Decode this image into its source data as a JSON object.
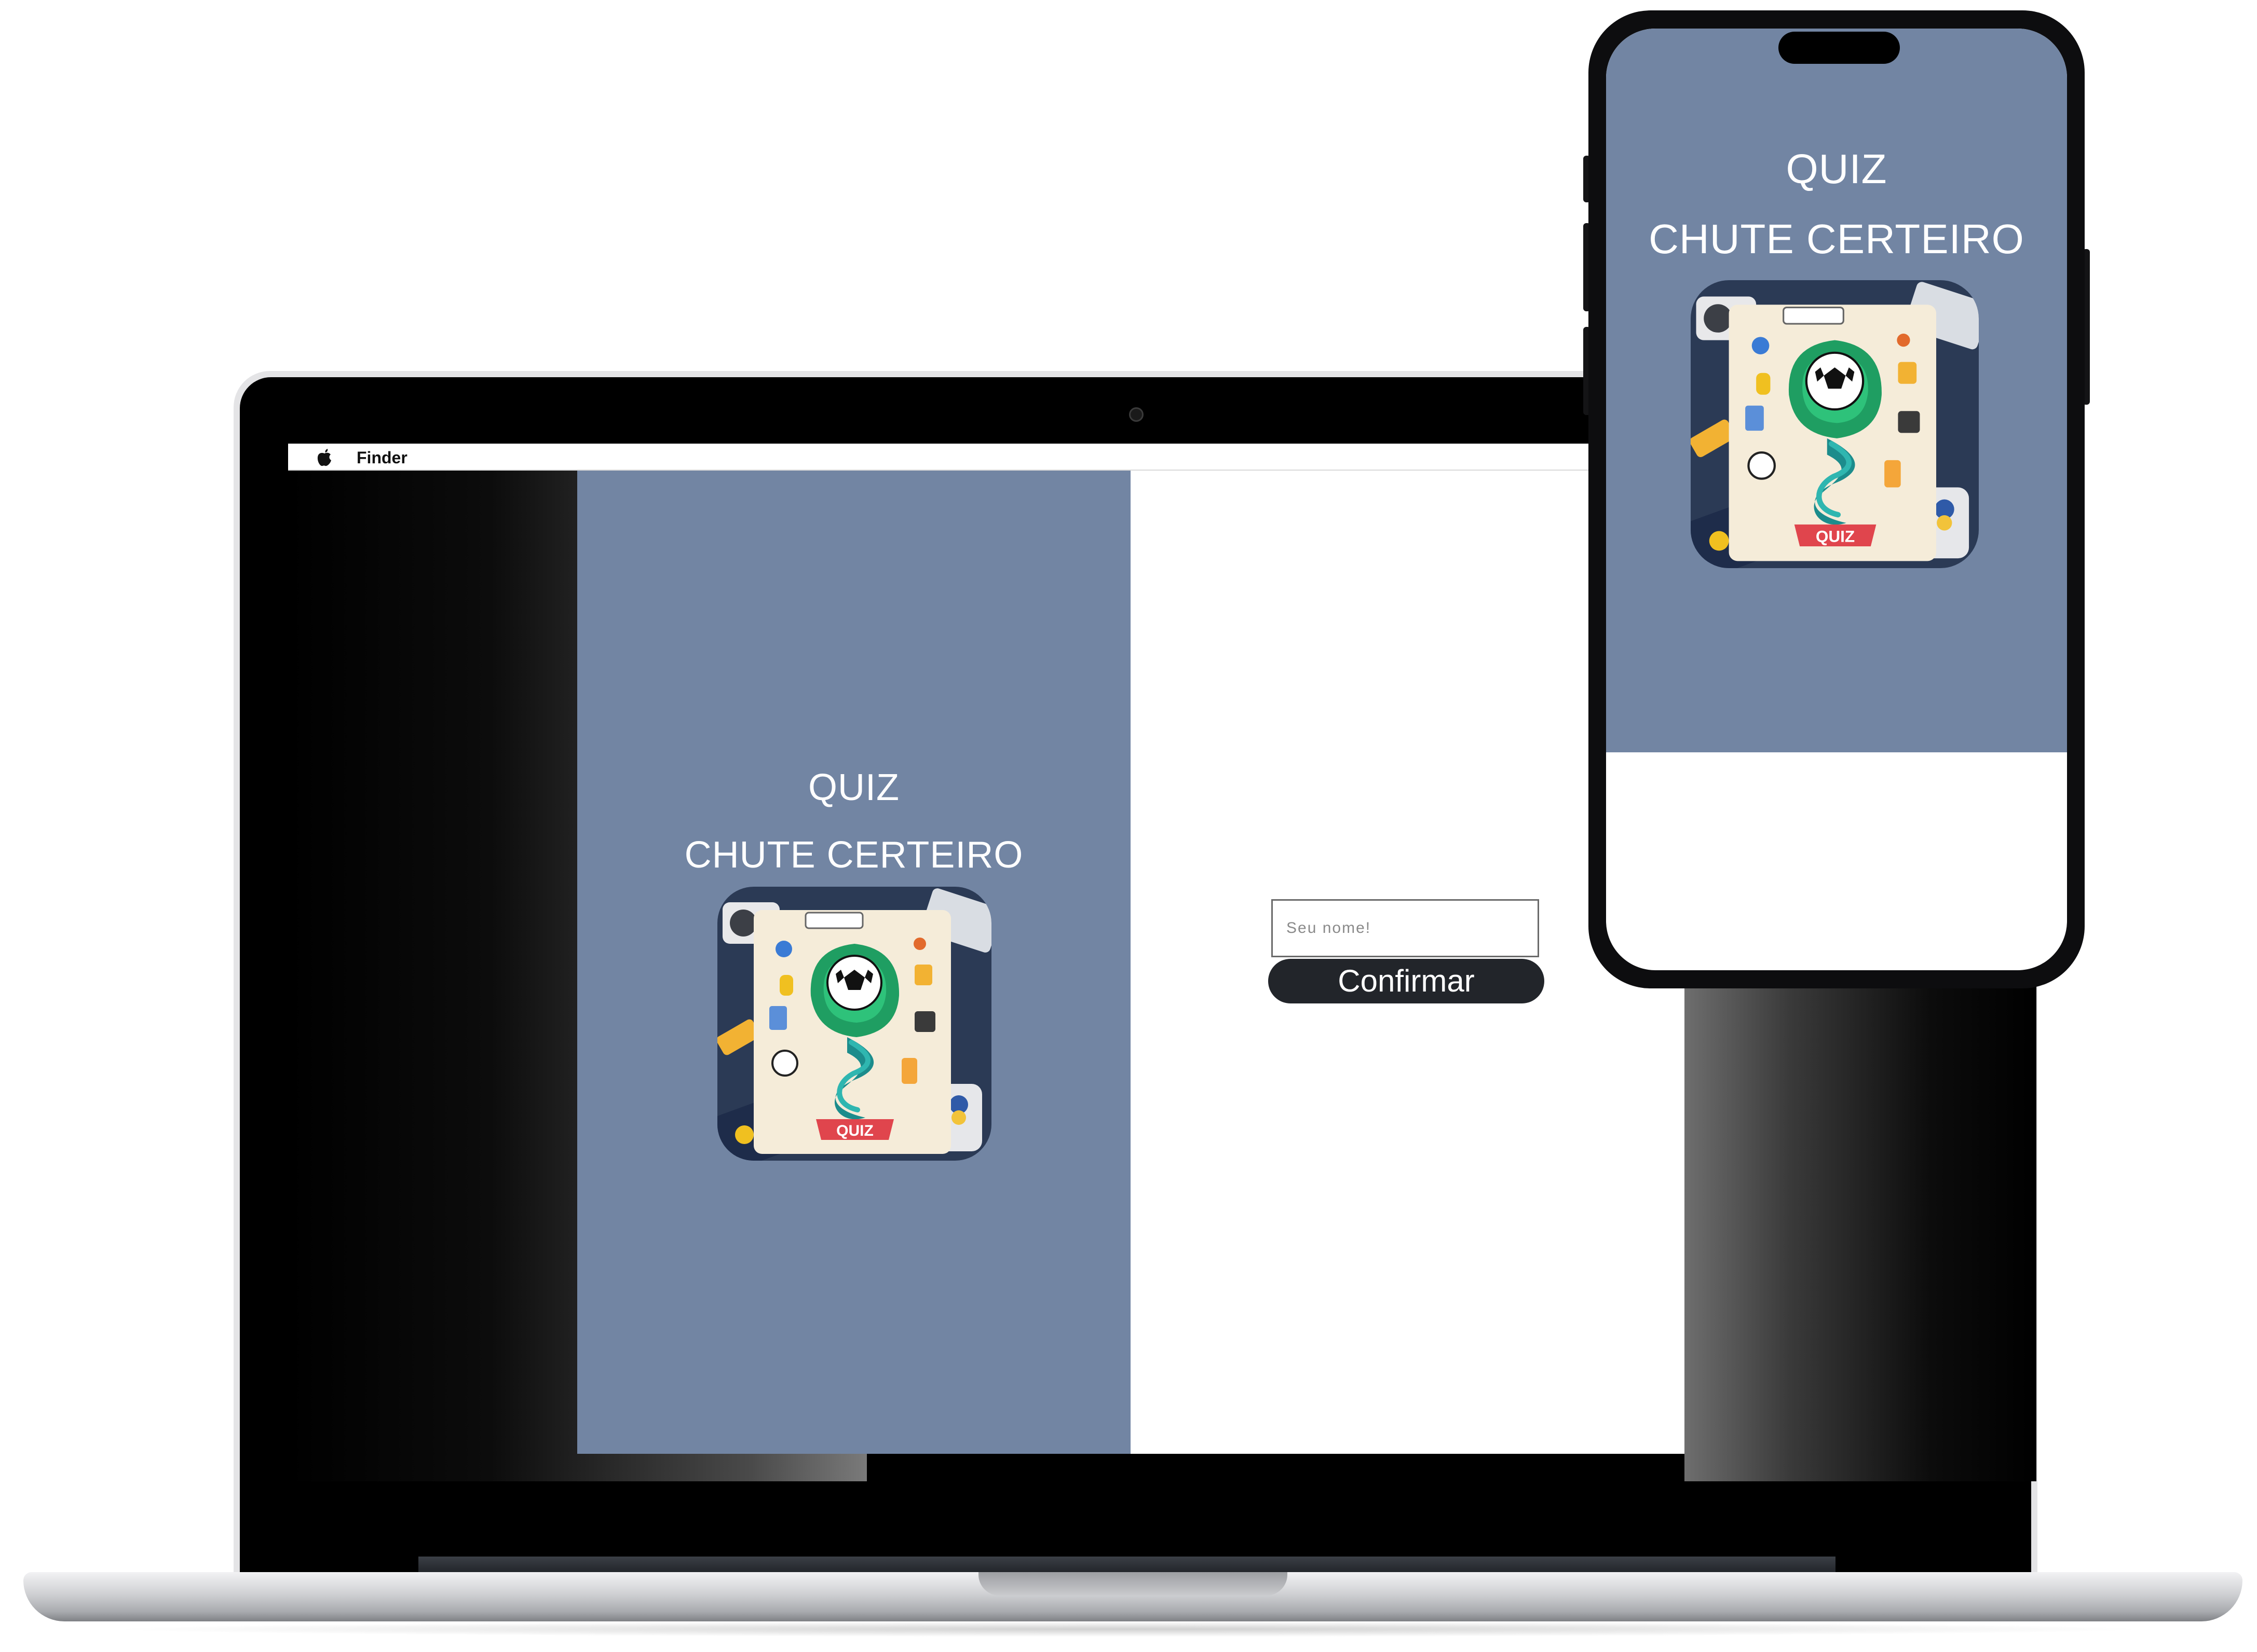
{
  "menubar": {
    "app_name": "Finder"
  },
  "quiz": {
    "title_line1": "QUIZ",
    "title_line2": "CHUTE CERTEIRO",
    "logo_banner": "QUIZ"
  },
  "form": {
    "name_placeholder": "Seu nome!",
    "name_value": "",
    "confirm_label": "Confirmar"
  },
  "colors": {
    "panel_blue": "#7285a3",
    "button_dark": "#22252a",
    "logo_green": "#1f9e62",
    "logo_teal": "#1c8c8c",
    "banner_red": "#e0454d"
  },
  "icons": [
    "apple-icon",
    "soccer-ball-icon",
    "webcam-icon"
  ]
}
